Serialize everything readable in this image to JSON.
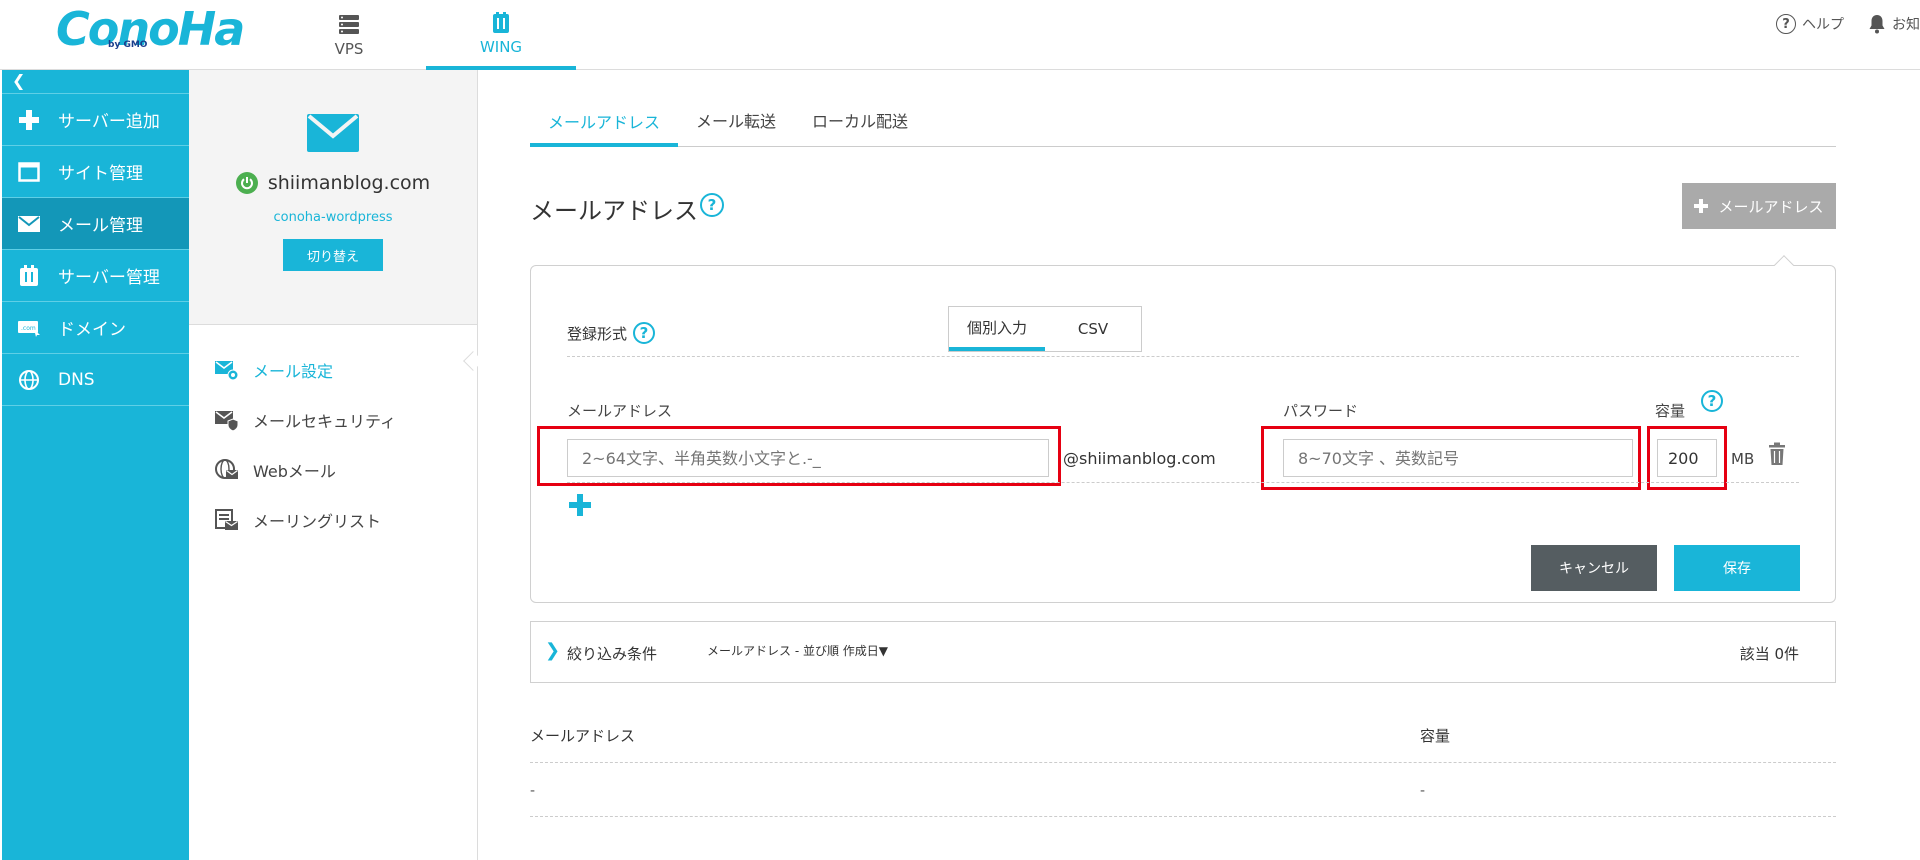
{
  "brand": {
    "logo_text": "ConoHa",
    "logo_sub": "by GMO"
  },
  "topnav": {
    "vps": "VPS",
    "wing": "WING"
  },
  "topright": {
    "help": "ヘルプ",
    "notice": "お知"
  },
  "sidebar": {
    "collapse": "❮",
    "items": [
      {
        "label": "サーバー追加"
      },
      {
        "label": "サイト管理"
      },
      {
        "label": "メール管理"
      },
      {
        "label": "サーバー管理"
      },
      {
        "label": "ドメイン"
      },
      {
        "label": "DNS"
      }
    ]
  },
  "subpanel": {
    "domain": "shiimanblog.com",
    "account": "conoha-wordpress",
    "switch_label": "切り替え",
    "items": [
      {
        "label": "メール設定"
      },
      {
        "label": "メールセキュリティ"
      },
      {
        "label": "Webメール"
      },
      {
        "label": "メーリングリスト"
      }
    ]
  },
  "tabs": [
    "メールアドレス",
    "メール転送",
    "ローカル配送"
  ],
  "page": {
    "title": "メールアドレス",
    "add_button": "メールアドレス"
  },
  "form": {
    "reg_label": "登録形式",
    "seg_individual": "個別入力",
    "seg_csv": "CSV",
    "col_email": "メールアドレス",
    "col_password": "パスワード",
    "col_capacity": "容量",
    "email_placeholder": "2~64文字、半角英数小文字と.-_",
    "domain_suffix": "@shiimanblog.com",
    "password_placeholder": "8~70文字 、英数記号",
    "capacity_value": "200",
    "capacity_unit": "MB",
    "cancel": "キャンセル",
    "save": "保存"
  },
  "filter": {
    "chevron": "❯",
    "label": "絞り込み条件",
    "meta": "メールアドレス  -     並び順  作成日▼",
    "count": "該当 0件"
  },
  "table": {
    "headers": [
      "メールアドレス",
      "容量"
    ],
    "rows": [
      [
        "-",
        "-"
      ]
    ]
  },
  "colors": {
    "accent": "#19b5d8",
    "highlight": "#e60012"
  }
}
